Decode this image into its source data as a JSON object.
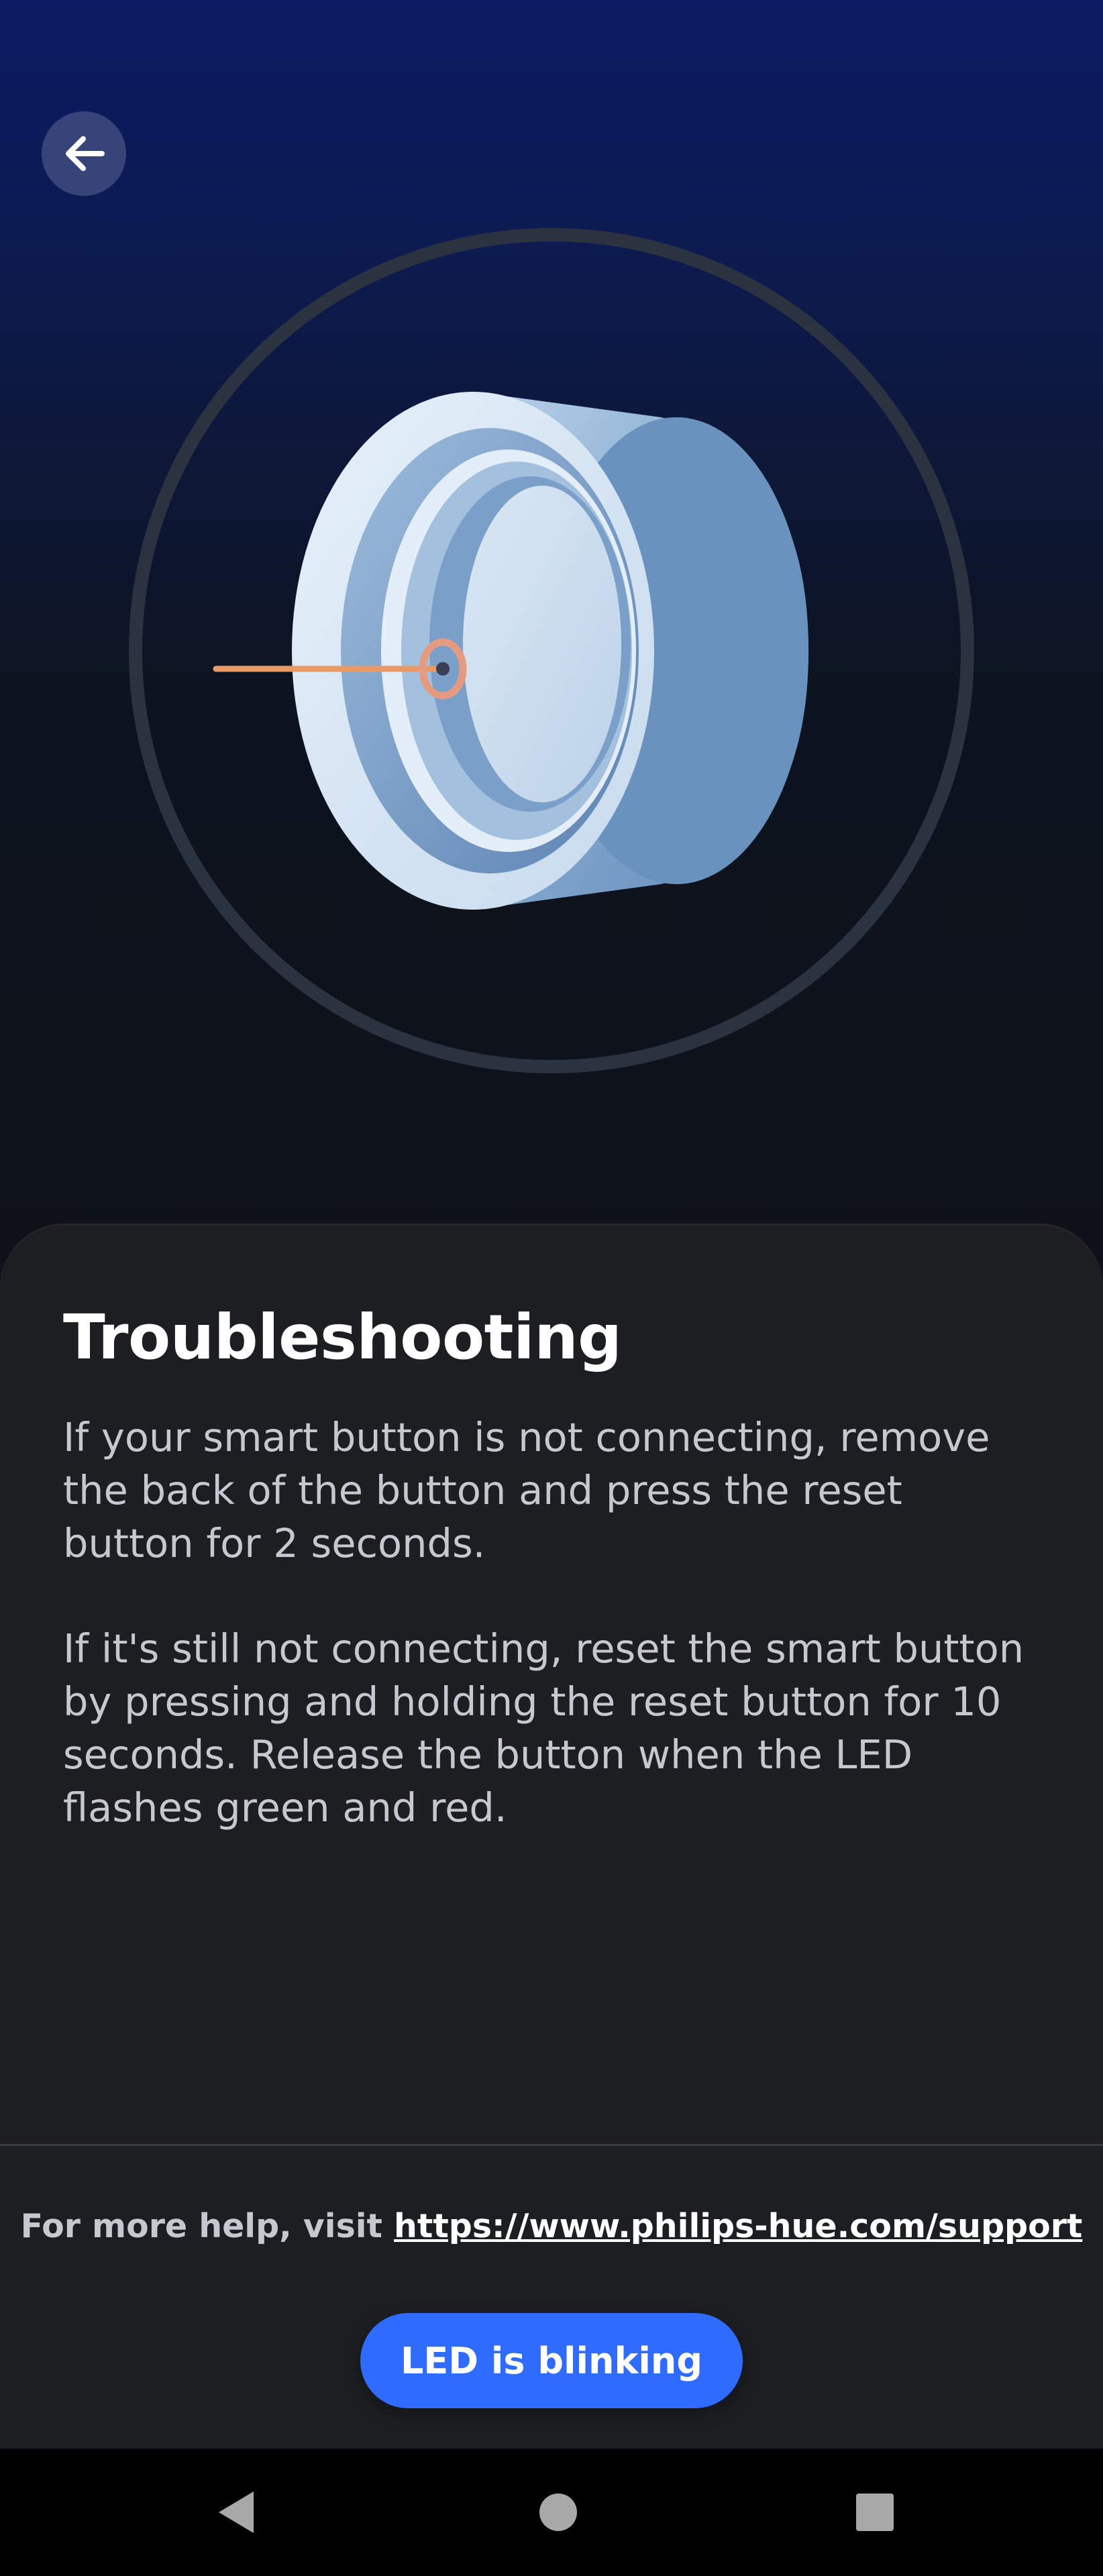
{
  "header": {
    "back_icon": "arrow-left-icon"
  },
  "illustration": {
    "subject": "smart-button-reset-icon",
    "colors": {
      "ring": "#2b3340",
      "body_light": "#d6e6f4",
      "body_mid": "#9fbedb",
      "body_dark": "#6f95c0",
      "pointer": "#e79a68"
    }
  },
  "content": {
    "title": "Troubleshooting",
    "paragraph_1": "If your smart button is not connecting, remove the back of the button and press the reset button for 2 seconds.",
    "paragraph_2": "If it's still not connecting, reset the smart button by pressing and holding the reset button for 10 seconds. Release the button when the LED flashes green and red."
  },
  "footer": {
    "help_prefix": "For more help, visit ",
    "help_link": "https://www.philips-hue.com/support",
    "primary_button_label": "LED is blinking"
  },
  "system_nav": {
    "back_icon": "triangle-back-icon",
    "home_icon": "circle-home-icon",
    "recents_icon": "square-recents-icon"
  },
  "colors": {
    "accent": "#2f6bff",
    "sheet_background": "#1c1e22",
    "text_primary": "#ffffff",
    "text_secondary": "#c5c8cf"
  }
}
